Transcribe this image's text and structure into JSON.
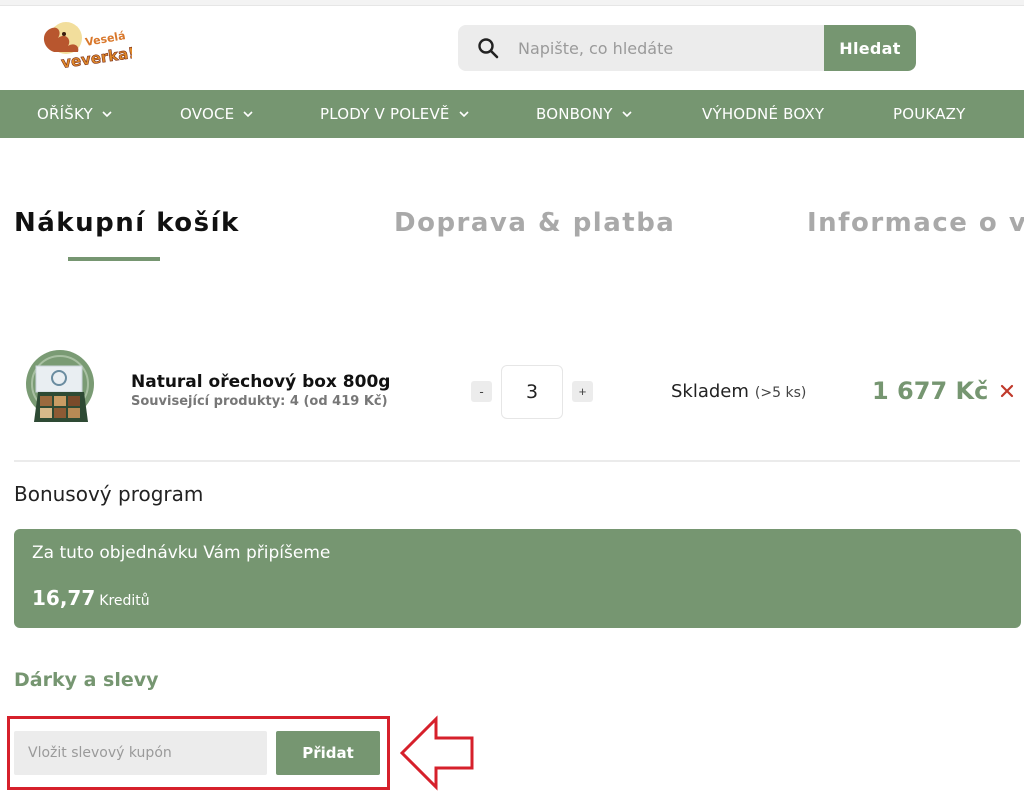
{
  "header": {
    "logo": {
      "text_line1": "Veselá",
      "text_line2": "veverka!"
    },
    "search": {
      "placeholder": "Napište, co hledáte",
      "button_label": "Hledat",
      "icon": "search-icon"
    }
  },
  "nav": {
    "items": [
      {
        "label": "OŘÍŠKY",
        "has_dropdown": true
      },
      {
        "label": "OVOCE",
        "has_dropdown": true
      },
      {
        "label": "PLODY V POLEVĚ",
        "has_dropdown": true
      },
      {
        "label": "BONBONY",
        "has_dropdown": true
      },
      {
        "label": "VÝHODNÉ BOXY",
        "has_dropdown": false
      },
      {
        "label": "POUKAZY",
        "has_dropdown": false
      }
    ]
  },
  "steps": [
    {
      "label": "Nákupní košík",
      "active": true
    },
    {
      "label": "Doprava & platba",
      "active": false
    },
    {
      "label": "Informace o vás",
      "active": false
    }
  ],
  "cart": {
    "items": [
      {
        "name": "Natural ořechový box 800g",
        "related": "Související produkty: 4 (od 419 Kč)",
        "qty_minus": "-",
        "quantity": "3",
        "qty_plus": "+",
        "stock_status": "Skladem",
        "stock_detail": "(>5 ks)",
        "price": "1 677 Kč"
      }
    ]
  },
  "bonus": {
    "title": "Bonusový program",
    "text": "Za tuto objednávku Vám připíšeme",
    "amount": "16,77",
    "unit": "Kreditů"
  },
  "gifts": {
    "title": "Dárky a slevy",
    "coupon_placeholder": "Vložit slevový kupón",
    "coupon_button": "Přidat"
  },
  "colors": {
    "accent": "#769671",
    "highlight": "#d6202b",
    "remove": "#c0392b",
    "inactive_step": "#a9a9a9",
    "field_bg": "#ececec"
  }
}
